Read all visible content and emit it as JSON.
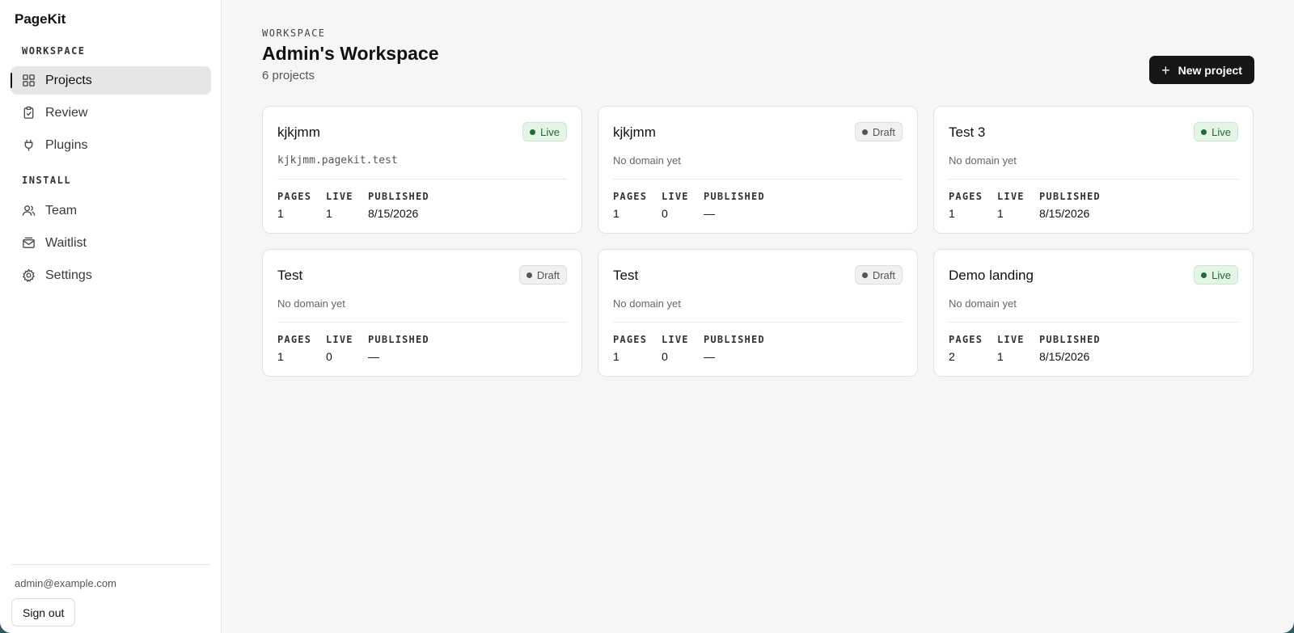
{
  "sidebar": {
    "brand": "PageKit",
    "sections": [
      {
        "label": "WORKSPACE",
        "items": [
          {
            "label": "Projects",
            "icon": "grid-icon",
            "active": true
          },
          {
            "label": "Review",
            "icon": "clipboard-check-icon",
            "active": false
          },
          {
            "label": "Plugins",
            "icon": "plug-icon",
            "active": false
          }
        ]
      },
      {
        "label": "INSTALL",
        "items": [
          {
            "label": "Team",
            "icon": "users-icon",
            "active": false
          },
          {
            "label": "Waitlist",
            "icon": "mail-stack-icon",
            "active": false
          },
          {
            "label": "Settings",
            "icon": "gear-icon",
            "active": false
          }
        ]
      }
    ],
    "user_email": "admin@example.com",
    "sign_out_label": "Sign out"
  },
  "header": {
    "eyebrow": "WORKSPACE",
    "title": "Admin's Workspace",
    "count": "6 projects",
    "new_project_label": "New project"
  },
  "stat_labels": {
    "pages": "PAGES",
    "live": "LIVE",
    "published": "PUBLISHED"
  },
  "projects": [
    {
      "name": "kjkjmm",
      "status": "Live",
      "domain": "kjkjmm.pagekit.test",
      "pages": "1",
      "live": "1",
      "published": "8/15/2026"
    },
    {
      "name": "kjkjmm",
      "status": "Draft",
      "domain": "No domain yet",
      "pages": "1",
      "live": "0",
      "published": "—"
    },
    {
      "name": "Test 3",
      "status": "Live",
      "domain": "No domain yet",
      "pages": "1",
      "live": "1",
      "published": "8/15/2026"
    },
    {
      "name": "Test",
      "status": "Draft",
      "domain": "No domain yet",
      "pages": "1",
      "live": "0",
      "published": "—"
    },
    {
      "name": "Test",
      "status": "Draft",
      "domain": "No domain yet",
      "pages": "1",
      "live": "0",
      "published": "—"
    },
    {
      "name": "Demo landing",
      "status": "Live",
      "domain": "No domain yet",
      "pages": "2",
      "live": "1",
      "published": "8/15/2026"
    }
  ],
  "colors": {
    "accent": "#161616",
    "live_badge": "#1f6b34",
    "live_badge_bg": "#e4f5e8",
    "draft_badge_bg": "#f1f1f1"
  }
}
